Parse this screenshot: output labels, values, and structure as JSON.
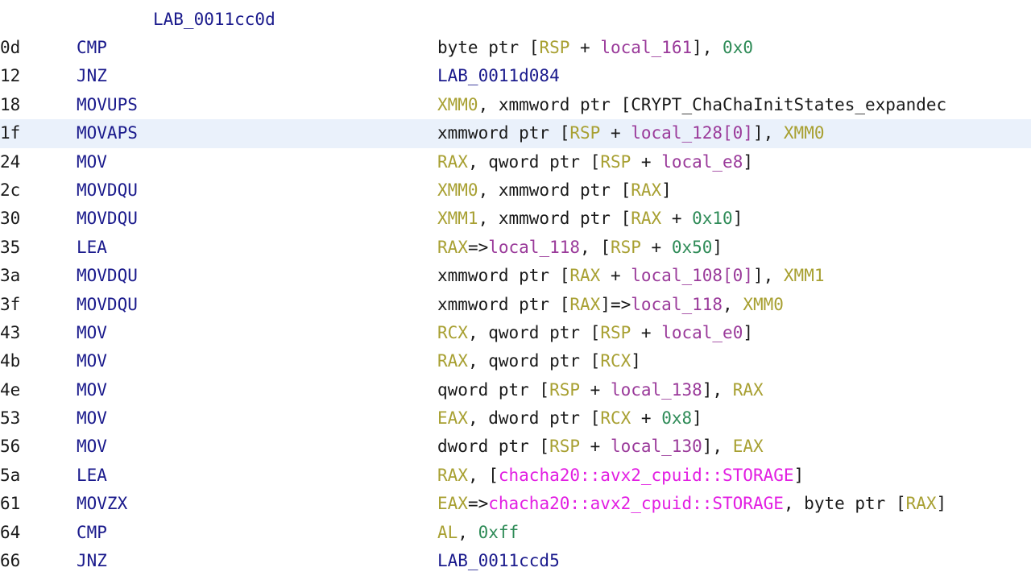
{
  "label": "LAB_0011cc0d",
  "colors": {
    "register": "#a8a032",
    "local_var": "#9a3a9a",
    "hex_literal": "#2e8b57",
    "symbol": "#e21ee2",
    "label": "#1a1a8c",
    "mnemonic": "#1a1a8c",
    "selection": "#eaf1fb"
  },
  "rows": [
    {
      "addr": "0d",
      "mnemonic": "CMP",
      "operands": [
        [
          "plain",
          "byte ptr ["
        ],
        [
          "reg",
          "RSP"
        ],
        [
          "plain",
          " + "
        ],
        [
          "var",
          "local_161"
        ],
        [
          "plain",
          "], "
        ],
        [
          "hex",
          "0x0"
        ]
      ]
    },
    {
      "addr": "12",
      "mnemonic": "JNZ",
      "operands": [
        [
          "lab",
          "LAB_0011d084"
        ]
      ]
    },
    {
      "addr": "18",
      "mnemonic": "MOVUPS",
      "operands": [
        [
          "reg",
          "XMM0"
        ],
        [
          "plain",
          ", xmmword ptr [CRYPT_ChaChaInitStates_expandec"
        ]
      ]
    },
    {
      "addr": "1f",
      "mnemonic": "MOVAPS",
      "selected": true,
      "operands": [
        [
          "plain",
          "xmmword ptr ["
        ],
        [
          "reg",
          "RSP"
        ],
        [
          "plain",
          " + "
        ],
        [
          "var",
          "local_128[0]"
        ],
        [
          "plain",
          "], "
        ],
        [
          "reg",
          "XMM0"
        ]
      ]
    },
    {
      "addr": "24",
      "mnemonic": "MOV",
      "operands": [
        [
          "reg",
          "RAX"
        ],
        [
          "plain",
          ", qword ptr ["
        ],
        [
          "reg",
          "RSP"
        ],
        [
          "plain",
          " + "
        ],
        [
          "var",
          "local_e8"
        ],
        [
          "plain",
          "]"
        ]
      ]
    },
    {
      "addr": "2c",
      "mnemonic": "MOVDQU",
      "operands": [
        [
          "reg",
          "XMM0"
        ],
        [
          "plain",
          ", xmmword ptr ["
        ],
        [
          "reg",
          "RAX"
        ],
        [
          "plain",
          "]"
        ]
      ]
    },
    {
      "addr": "30",
      "mnemonic": "MOVDQU",
      "operands": [
        [
          "reg",
          "XMM1"
        ],
        [
          "plain",
          ", xmmword ptr ["
        ],
        [
          "reg",
          "RAX"
        ],
        [
          "plain",
          " + "
        ],
        [
          "hex",
          "0x10"
        ],
        [
          "plain",
          "]"
        ]
      ]
    },
    {
      "addr": "35",
      "mnemonic": "LEA",
      "operands": [
        [
          "reg",
          "RAX"
        ],
        [
          "plain",
          "=>"
        ],
        [
          "var",
          "local_118"
        ],
        [
          "plain",
          ", ["
        ],
        [
          "reg",
          "RSP"
        ],
        [
          "plain",
          " + "
        ],
        [
          "hex",
          "0x50"
        ],
        [
          "plain",
          "]"
        ]
      ]
    },
    {
      "addr": "3a",
      "mnemonic": "MOVDQU",
      "operands": [
        [
          "plain",
          "xmmword ptr ["
        ],
        [
          "reg",
          "RAX"
        ],
        [
          "plain",
          " + "
        ],
        [
          "var",
          "local_108[0]"
        ],
        [
          "plain",
          "], "
        ],
        [
          "reg",
          "XMM1"
        ]
      ]
    },
    {
      "addr": "3f",
      "mnemonic": "MOVDQU",
      "operands": [
        [
          "plain",
          "xmmword ptr ["
        ],
        [
          "reg",
          "RAX"
        ],
        [
          "plain",
          "]=>"
        ],
        [
          "var",
          "local_118"
        ],
        [
          "plain",
          ", "
        ],
        [
          "reg",
          "XMM0"
        ]
      ]
    },
    {
      "addr": "43",
      "mnemonic": "MOV",
      "operands": [
        [
          "reg",
          "RCX"
        ],
        [
          "plain",
          ", qword ptr ["
        ],
        [
          "reg",
          "RSP"
        ],
        [
          "plain",
          " + "
        ],
        [
          "var",
          "local_e0"
        ],
        [
          "plain",
          "]"
        ]
      ]
    },
    {
      "addr": "4b",
      "mnemonic": "MOV",
      "operands": [
        [
          "reg",
          "RAX"
        ],
        [
          "plain",
          ", qword ptr ["
        ],
        [
          "reg",
          "RCX"
        ],
        [
          "plain",
          "]"
        ]
      ]
    },
    {
      "addr": "4e",
      "mnemonic": "MOV",
      "operands": [
        [
          "plain",
          "qword ptr ["
        ],
        [
          "reg",
          "RSP"
        ],
        [
          "plain",
          " + "
        ],
        [
          "var",
          "local_138"
        ],
        [
          "plain",
          "], "
        ],
        [
          "reg",
          "RAX"
        ]
      ]
    },
    {
      "addr": "53",
      "mnemonic": "MOV",
      "operands": [
        [
          "reg",
          "EAX"
        ],
        [
          "plain",
          ", dword ptr ["
        ],
        [
          "reg",
          "RCX"
        ],
        [
          "plain",
          " + "
        ],
        [
          "hex",
          "0x8"
        ],
        [
          "plain",
          "]"
        ]
      ]
    },
    {
      "addr": "56",
      "mnemonic": "MOV",
      "operands": [
        [
          "plain",
          "dword ptr ["
        ],
        [
          "reg",
          "RSP"
        ],
        [
          "plain",
          " + "
        ],
        [
          "var",
          "local_130"
        ],
        [
          "plain",
          "], "
        ],
        [
          "reg",
          "EAX"
        ]
      ]
    },
    {
      "addr": "5a",
      "mnemonic": "LEA",
      "operands": [
        [
          "reg",
          "RAX"
        ],
        [
          "plain",
          ", ["
        ],
        [
          "sym",
          "chacha20::avx2_cpuid::STORAGE"
        ],
        [
          "plain",
          "]"
        ]
      ]
    },
    {
      "addr": "61",
      "mnemonic": "MOVZX",
      "operands": [
        [
          "reg",
          "EAX"
        ],
        [
          "plain",
          "=>"
        ],
        [
          "sym",
          "chacha20::avx2_cpuid::STORAGE"
        ],
        [
          "plain",
          ", byte ptr ["
        ],
        [
          "reg",
          "RAX"
        ],
        [
          "plain",
          "]"
        ]
      ]
    },
    {
      "addr": "64",
      "mnemonic": "CMP",
      "operands": [
        [
          "reg",
          "AL"
        ],
        [
          "plain",
          ", "
        ],
        [
          "hex",
          "0xff"
        ]
      ]
    },
    {
      "addr": "66",
      "mnemonic": "JNZ",
      "operands": [
        [
          "lab",
          "LAB_0011ccd5"
        ]
      ]
    }
  ]
}
